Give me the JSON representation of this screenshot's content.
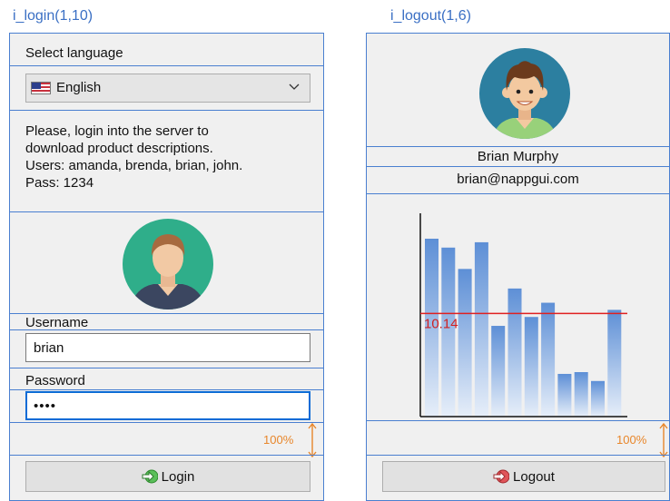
{
  "captions": {
    "login": "i_login(1,10)",
    "logout": "i_logout(1,6)"
  },
  "login_panel": {
    "language_label": "Select language",
    "language": {
      "selected": "English",
      "flag_icon": "us-flag-icon"
    },
    "info_lines": [
      "Please, login into the server to",
      "download product descriptions.",
      "Users: amanda, brenda, brian, john.",
      "Pass: 1234"
    ],
    "username_label": "Username",
    "username_value": "brian",
    "password_label": "Password",
    "password_value": "••••",
    "zoom": "100%",
    "login_button": "Login"
  },
  "logout_panel": {
    "user_name": "Brian Murphy",
    "user_email": "brian@nappgui.com",
    "zoom": "100%",
    "logout_button": "Logout"
  },
  "chart_data": {
    "type": "bar",
    "values": [
      100,
      95,
      83,
      98,
      51,
      72,
      56,
      64,
      24,
      25,
      20,
      60
    ],
    "reference_line": {
      "value": 10.14,
      "label": "10.14"
    },
    "colors": {
      "bar": "#5d8fd6",
      "line": "#e02020",
      "label": "#d02020"
    }
  }
}
